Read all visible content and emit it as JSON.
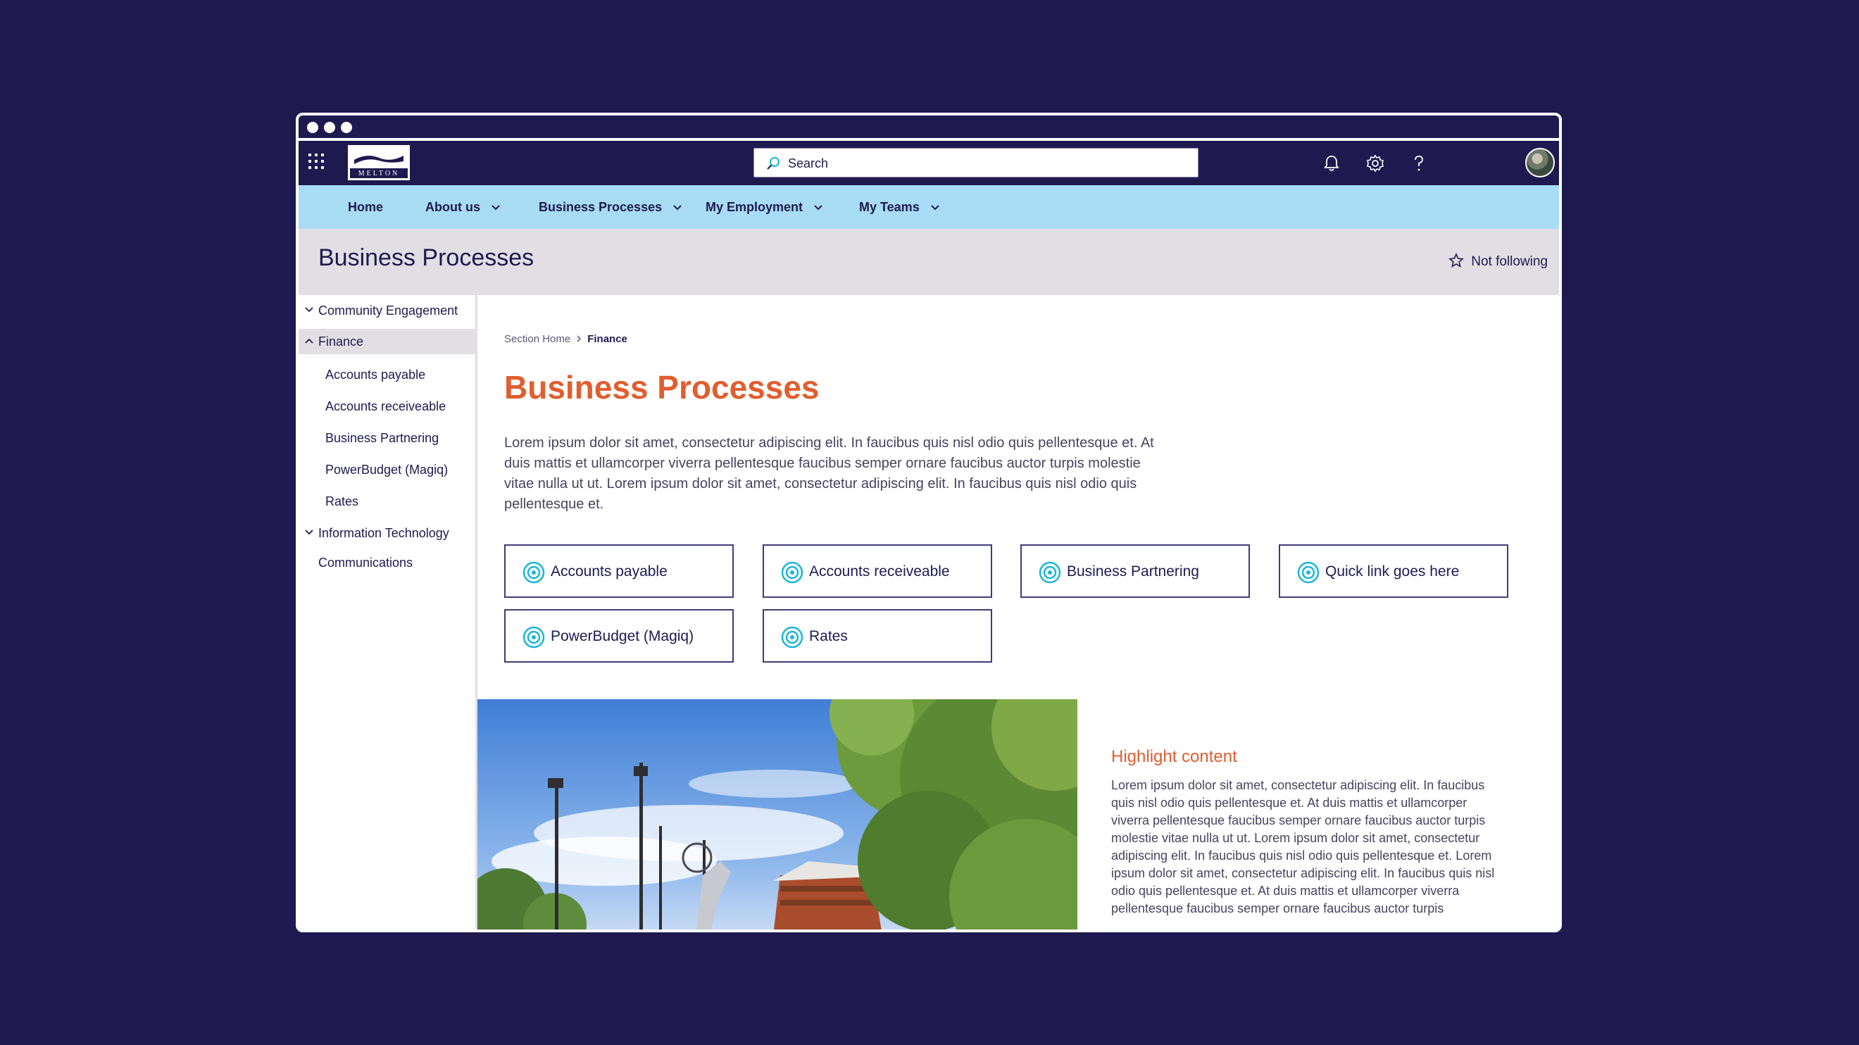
{
  "logo": {
    "text": "MELTON"
  },
  "search": {
    "placeholder": "Search"
  },
  "nav": {
    "items": [
      {
        "label": "Home",
        "dropdown": false
      },
      {
        "label": "About us",
        "dropdown": true
      },
      {
        "label": "Business Processes",
        "dropdown": true
      },
      {
        "label": "My Employment",
        "dropdown": true
      },
      {
        "label": "My Teams",
        "dropdown": true
      }
    ]
  },
  "header": {
    "title": "Business Processes",
    "follow_label": "Not following"
  },
  "sidebar": {
    "community": "Community Engagement",
    "finance": "Finance",
    "finance_children": [
      "Accounts payable",
      "Accounts receiveable",
      "Business Partnering",
      "PowerBudget (Magiq)",
      "Rates"
    ],
    "it": "Information Technology",
    "communications": "Communications"
  },
  "breadcrumb": {
    "home": "Section Home",
    "current": "Finance"
  },
  "main": {
    "title": "Business Processes",
    "intro": "Lorem ipsum dolor sit amet, consectetur adipiscing elit. In faucibus quis nisl odio quis pellentesque et. At duis mattis et ullamcorper viverra pellentesque faucibus semper ornare faucibus auctor turpis molestie vitae nulla ut ut. Lorem ipsum dolor sit amet, consectetur adipiscing elit. In faucibus quis nisl odio quis pellentesque et.",
    "quick_links": [
      "Accounts payable",
      "Accounts receiveable",
      "Business Partnering",
      "Quick link goes here",
      "PowerBudget (Magiq)",
      "Rates"
    ]
  },
  "highlight": {
    "title": "Highlight content",
    "text": "Lorem ipsum dolor sit amet, consectetur adipiscing elit. In faucibus quis nisl odio quis pellentesque et. At duis mattis et ullamcorper viverra pellentesque faucibus semper ornare faucibus auctor turpis molestie vitae nulla ut ut. Lorem ipsum dolor sit amet, consectetur adipiscing elit. In faucibus quis nisl odio quis pellentesque et. Lorem ipsum dolor sit amet, consectetur adipiscing elit. In faucibus quis nisl odio quis pellentesque et. At duis mattis et ullamcorper viverra pellentesque faucibus semper ornare faucibus auctor turpis"
  },
  "colors": {
    "background": "#1e1a4f",
    "nav": "#a8dcf5",
    "accent": "#e05e30",
    "quick_link_icon": "#1bb6d6"
  },
  "icons": [
    "app-launcher-icon",
    "search-icon",
    "bell-icon",
    "gear-icon",
    "help-icon",
    "chevron-down-icon",
    "star-icon",
    "target-icon"
  ]
}
